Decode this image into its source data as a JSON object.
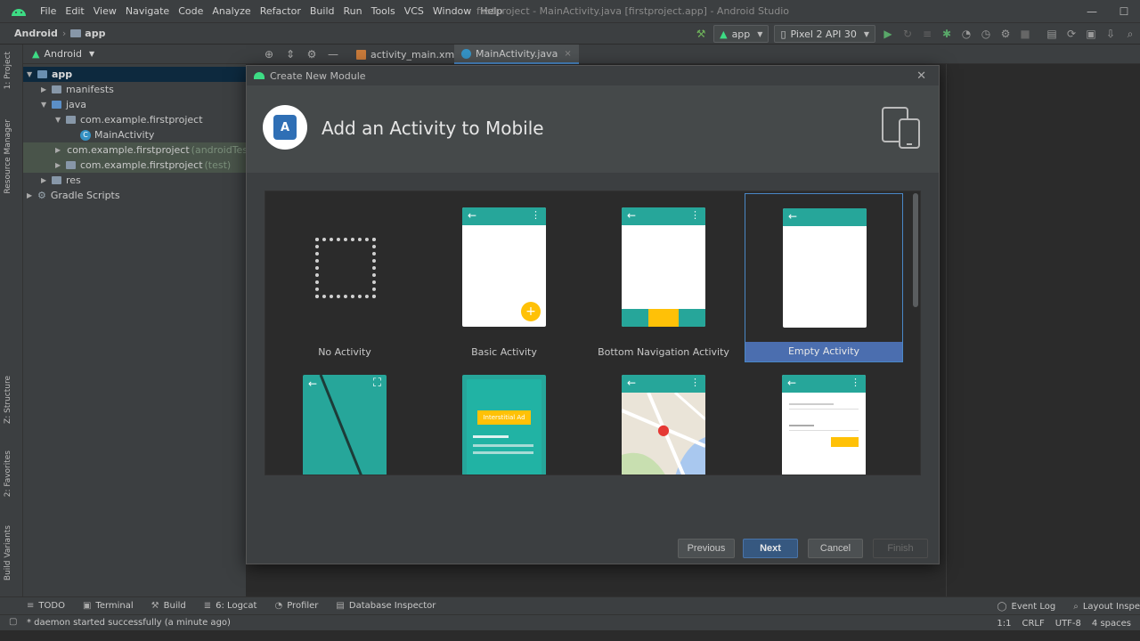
{
  "menubar": {
    "items": [
      "File",
      "Edit",
      "View",
      "Navigate",
      "Code",
      "Analyze",
      "Refactor",
      "Build",
      "Run",
      "Tools",
      "VCS",
      "Window",
      "Help"
    ],
    "window_title": "firstproject - MainActivity.java [firstproject.app] - Android Studio"
  },
  "navbar": {
    "root": "Android",
    "module": "app",
    "run_config": "app",
    "device": "Pixel 2 API 30"
  },
  "project_panel": {
    "view_mode": "Android",
    "tree": [
      {
        "label": "app",
        "suffix": ""
      },
      {
        "label": "manifests",
        "suffix": ""
      },
      {
        "label": "java",
        "suffix": ""
      },
      {
        "label": "com.example.firstproject",
        "suffix": ""
      },
      {
        "label": "MainActivity",
        "suffix": ""
      },
      {
        "label": "com.example.firstproject",
        "suffix": "(androidTest)"
      },
      {
        "label": "com.example.firstproject",
        "suffix": "(test)"
      },
      {
        "label": "res",
        "suffix": ""
      },
      {
        "label": "Gradle Scripts",
        "suffix": ""
      }
    ]
  },
  "side_tabs": {
    "project": "1: Project",
    "resource_manager": "Resource Manager",
    "structure": "Z: Structure",
    "favorites": "2: Favorites",
    "build_variants": "Build Variants"
  },
  "editor_tabs": [
    {
      "label": "activity_main.xml"
    },
    {
      "label": "MainActivity.java"
    }
  ],
  "dialog": {
    "title": "Create New Module",
    "heading": "Add an Activity to Mobile",
    "templates": [
      {
        "label": "No Activity"
      },
      {
        "label": "Basic Activity"
      },
      {
        "label": "Bottom Navigation Activity"
      },
      {
        "label": "Empty Activity"
      }
    ],
    "interstitial_label": "Interstitial Ad",
    "buttons": {
      "previous": "Previous",
      "next": "Next",
      "cancel": "Cancel",
      "finish": "Finish"
    }
  },
  "bottom_tools": {
    "todo": "TODO",
    "terminal": "Terminal",
    "build": "Build",
    "logcat": "6: Logcat",
    "profiler": "Profiler",
    "database_inspector": "Database Inspector",
    "event_log": "Event Log",
    "layout_inspector": "Layout Inspe"
  },
  "status": {
    "message": "* daemon started successfully (a minute ago)",
    "position": "1:1",
    "line_sep": "CRLF",
    "encoding": "UTF-8",
    "indent": "4 spaces"
  },
  "colors": {
    "accent": "#4b6eaf",
    "teal": "#26a69a",
    "amber": "#ffc107"
  }
}
